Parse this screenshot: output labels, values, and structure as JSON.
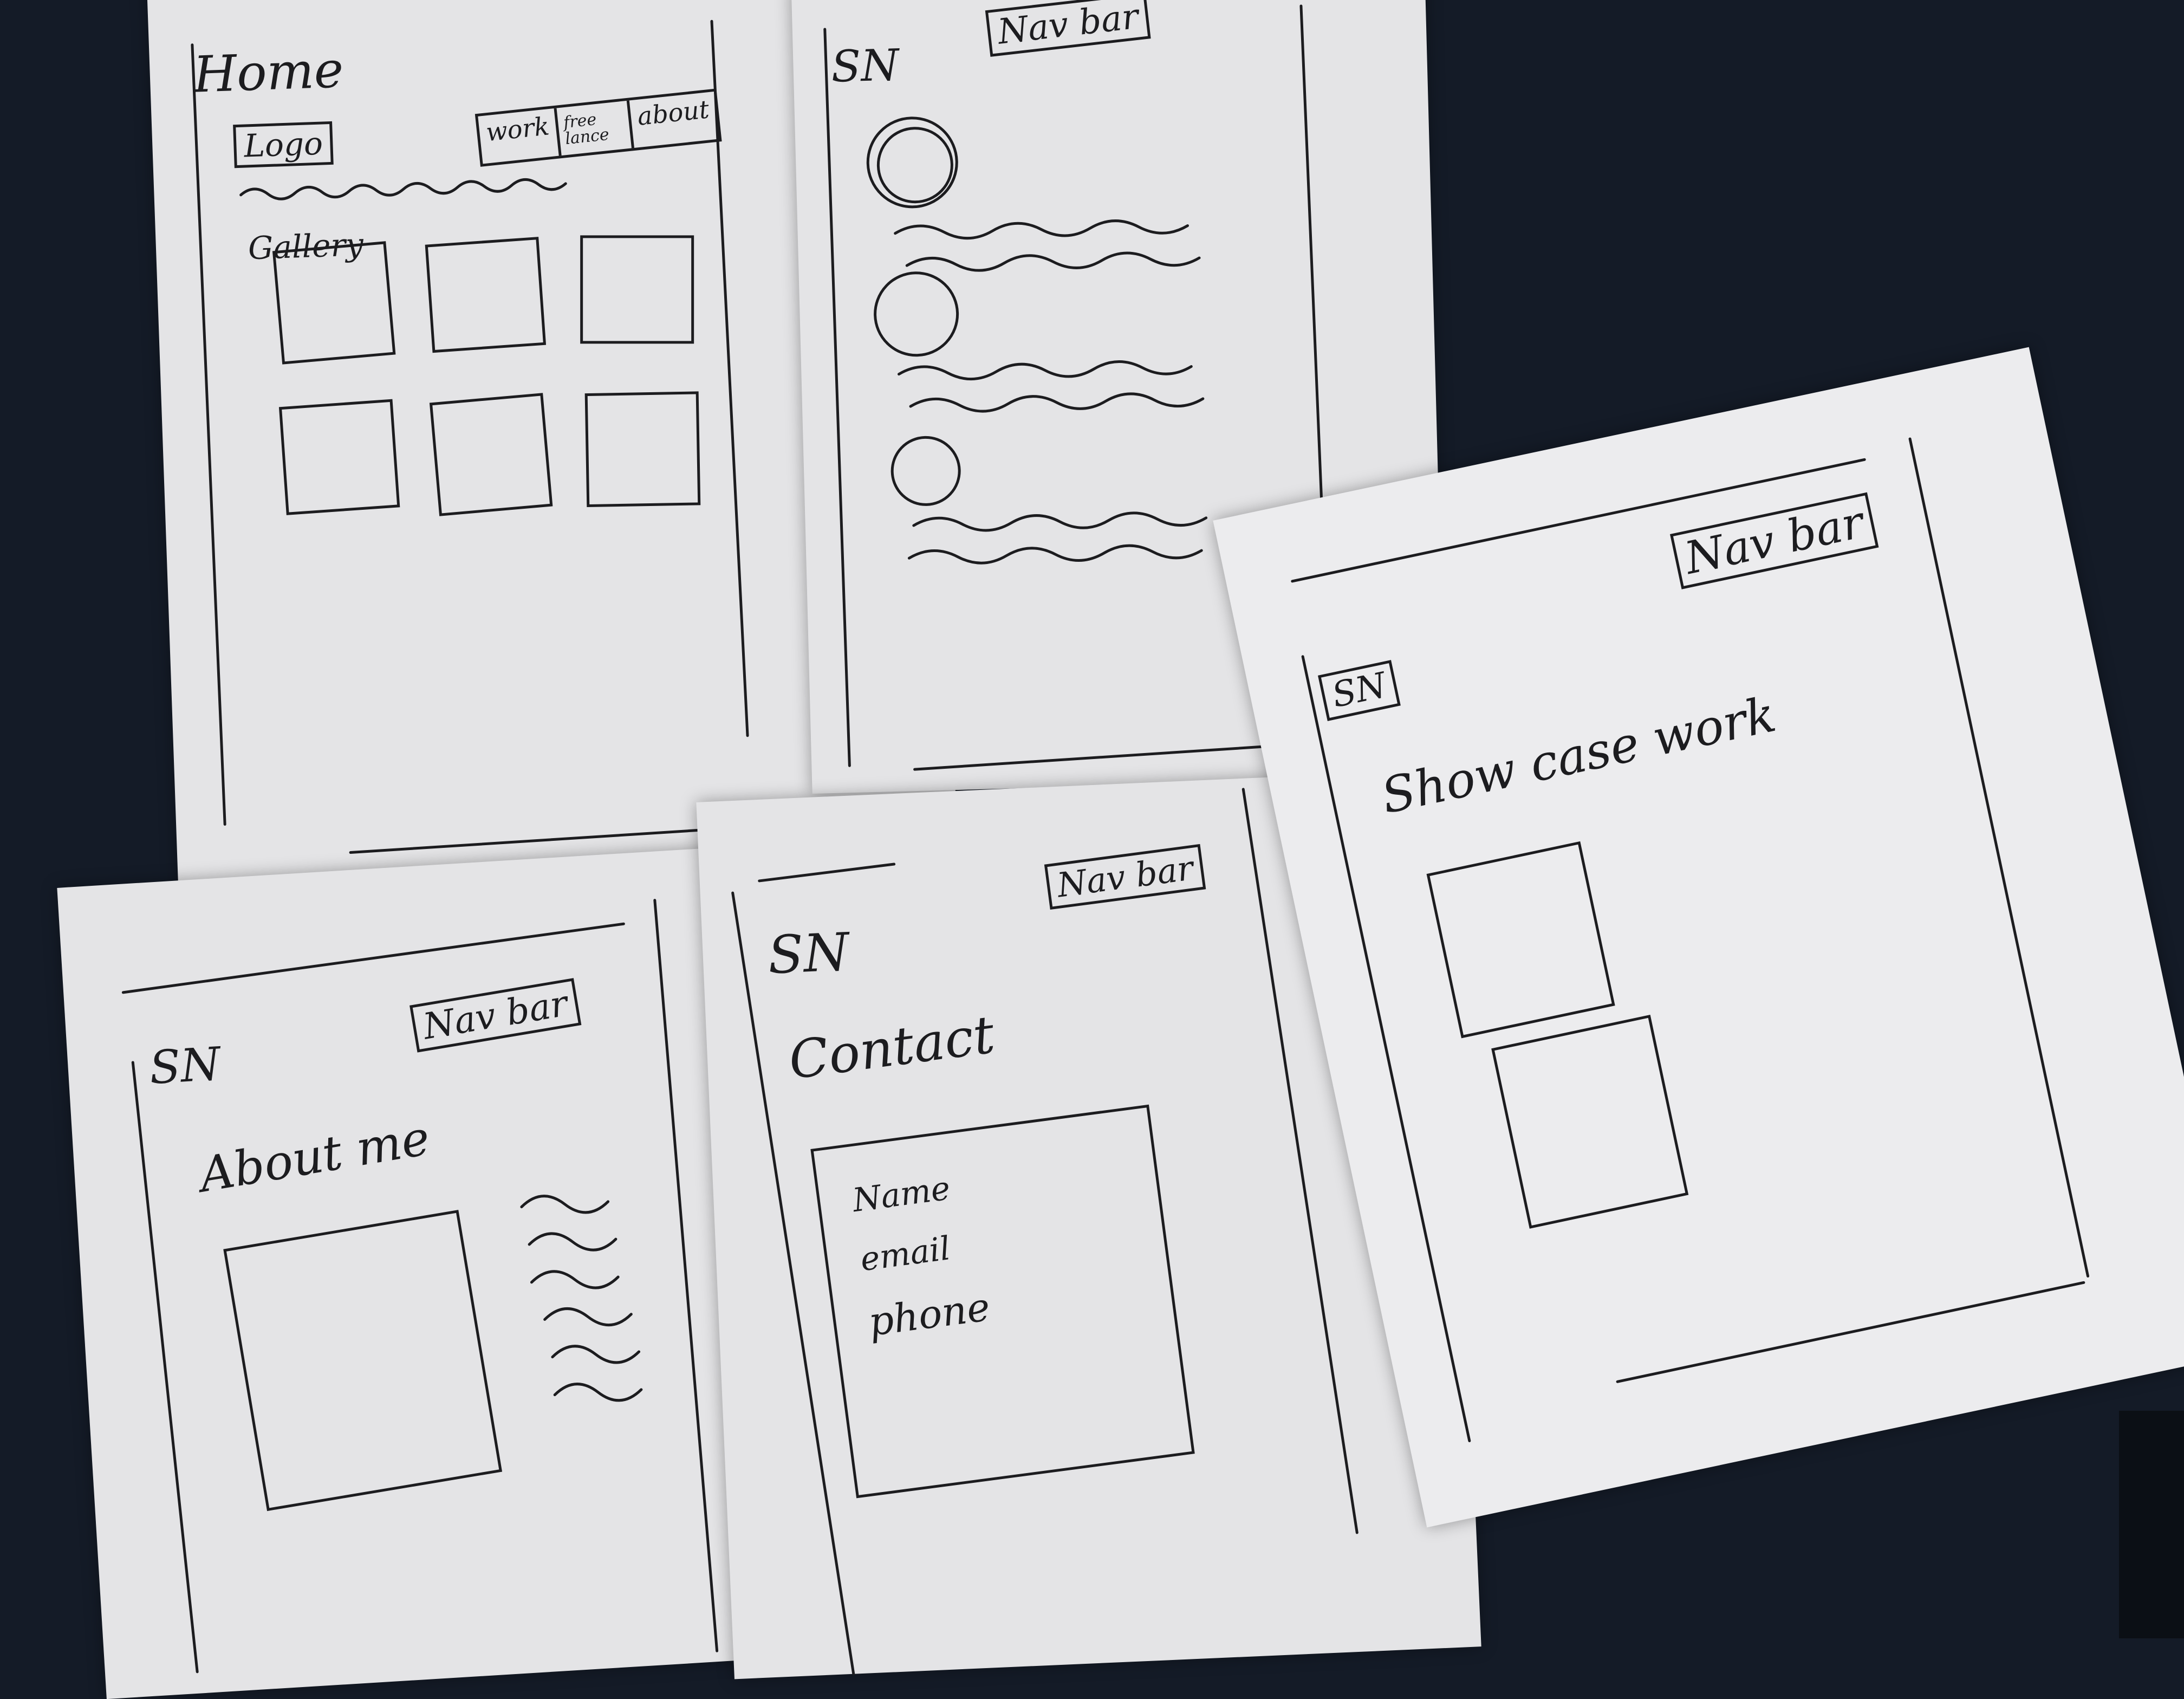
{
  "colors": {
    "table": "#141b27",
    "paper": "#e4e4e6",
    "ink": "#1c1c1f"
  },
  "sheets": {
    "home": {
      "title": "Home",
      "logo": "Logo",
      "nav": [
        "work",
        "free lance",
        "about"
      ],
      "gallery_label": "Gallery",
      "gallery_thumbnail_count": 6
    },
    "blog": {
      "initials": "SN",
      "nav": "Nav bar",
      "item_count": 3
    },
    "about": {
      "initials": "SN",
      "nav": "Nav bar",
      "heading": "About me"
    },
    "contact": {
      "initials": "SN",
      "nav": "Nav bar",
      "heading": "Contact",
      "fields": [
        "Name",
        "email",
        "phone"
      ]
    },
    "showcase": {
      "initials": "SN",
      "nav": "Nav bar",
      "heading": "Show case work"
    }
  }
}
